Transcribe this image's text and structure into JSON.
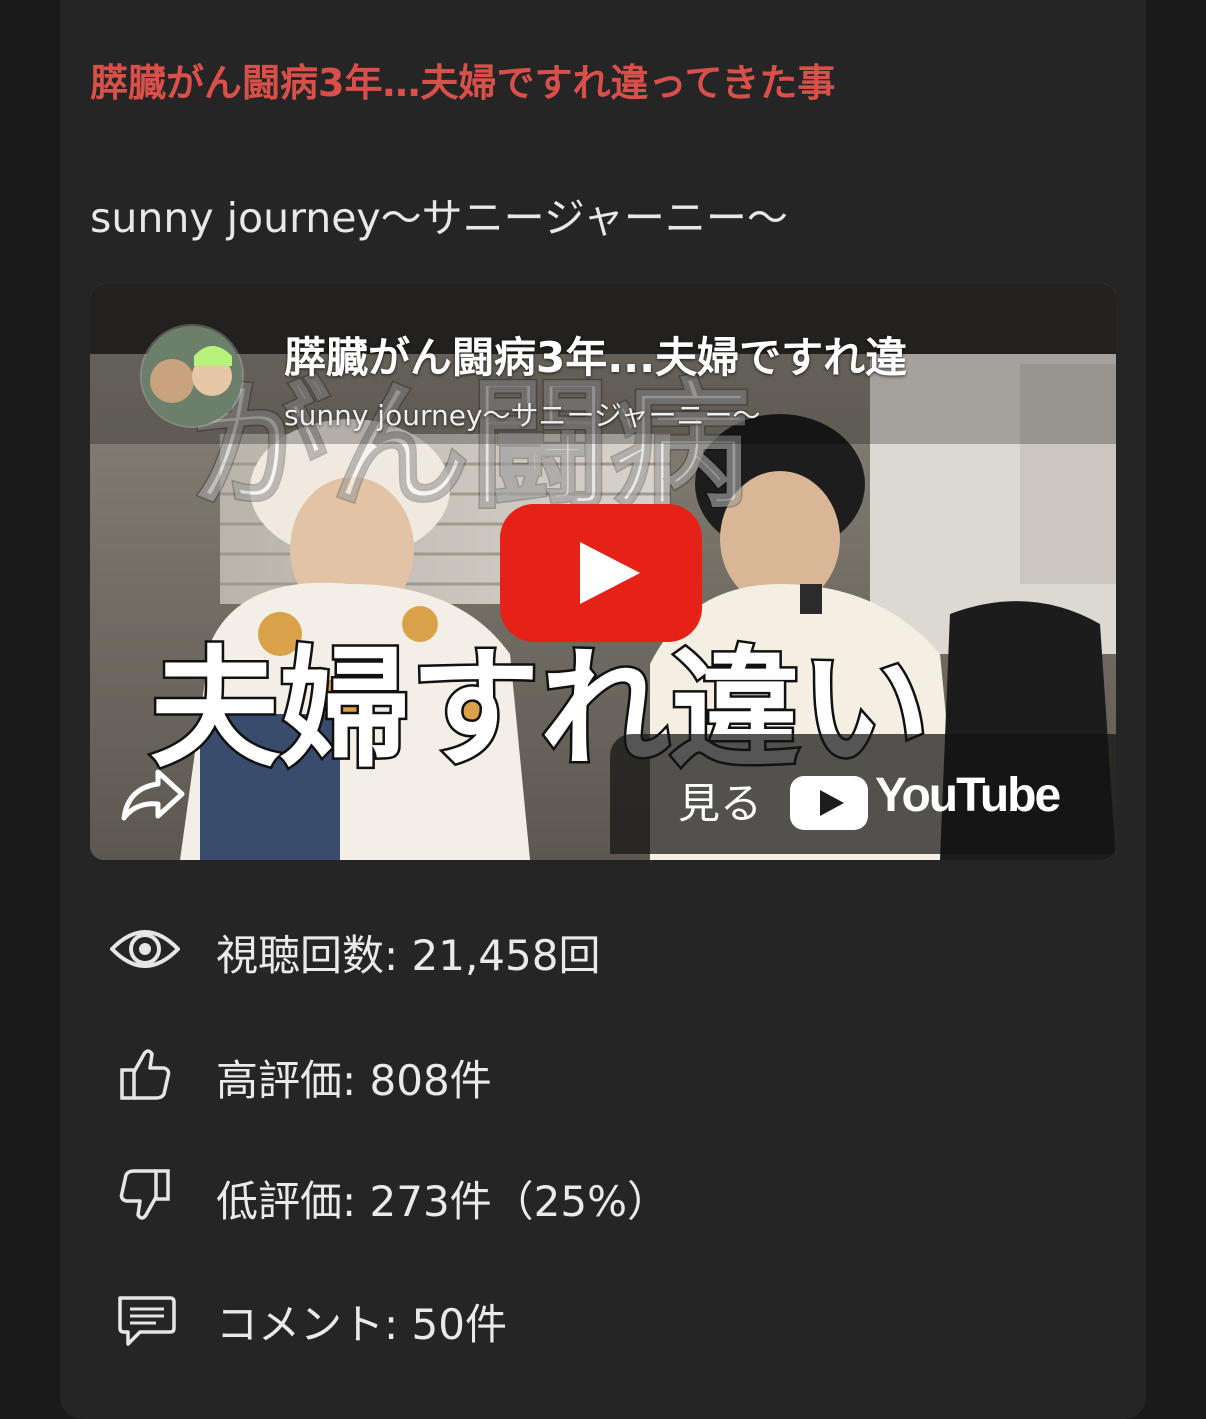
{
  "post": {
    "title": "膵臓がん闘病3年…夫婦ですれ違ってきた事",
    "channel": "sunny journey〜サニージャーニー〜"
  },
  "player": {
    "video_title": "膵臓がん闘病3年...夫婦ですれ違",
    "channel_name": "sunny journey〜サニージャーニー〜",
    "thumbnail_caption": "夫婦すれ違い",
    "thumbnail_bg_text": "がん闘病",
    "watch_on_label": "見る",
    "youtube_label": "YouTube",
    "icons": {
      "play": "play-icon",
      "share": "share-icon",
      "youtube": "youtube-logo-icon"
    },
    "accent_color": "#e62117"
  },
  "stats": [
    {
      "icon": "eye-icon",
      "label": "視聴回数: 21,458回"
    },
    {
      "icon": "thumbs-up-icon",
      "label": "高評価: 808件"
    },
    {
      "icon": "thumbs-down-icon",
      "label": "低評価: 273件（25%）"
    },
    {
      "icon": "comment-icon",
      "label": "コメント: 50件"
    }
  ],
  "colors": {
    "title": "#d9504a",
    "card_background": "#252525",
    "page_background": "#1a1a1a"
  }
}
